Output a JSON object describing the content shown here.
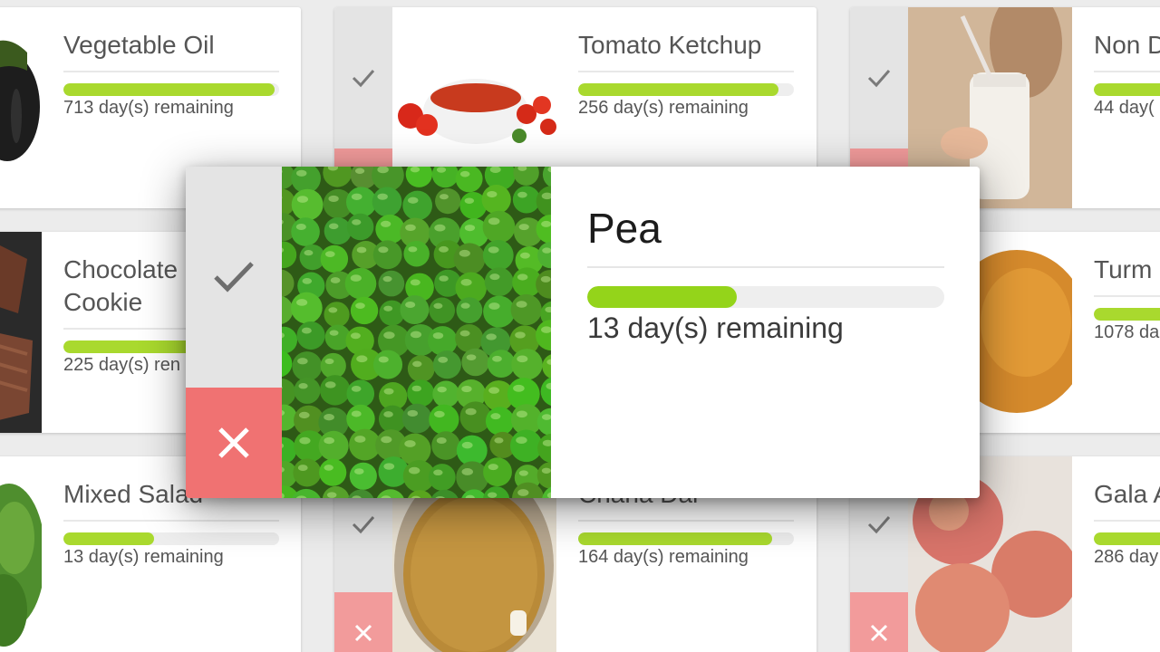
{
  "cards": [
    {
      "id": "vegetable-oil",
      "title": "Vegetable Oil",
      "remaining": "713 day(s) remaining",
      "progress": 0.98
    },
    {
      "id": "tomato-ketchup",
      "title": "Tomato Ketchup",
      "remaining": "256 day(s) remaining",
      "progress": 0.93
    },
    {
      "id": "non-dairy",
      "title": "Non D",
      "remaining": "44 day(",
      "progress": 0.9
    },
    {
      "id": "chocolate-cookie",
      "title_line1": "Chocolate",
      "title_line2": "Cookie",
      "remaining": "225 day(s) ren",
      "progress": 0.9
    },
    {
      "id": "turmeric",
      "title": "Turm",
      "remaining": "1078 da",
      "progress": 0.95
    },
    {
      "id": "mixed-salad",
      "title": "Mixed Salad",
      "remaining": "13 day(s) remaining",
      "progress": 0.42
    },
    {
      "id": "chana-dal",
      "title": "Chana Dal",
      "remaining": "164 day(s) remaining",
      "progress": 0.9
    },
    {
      "id": "gala-apple",
      "title": "Gala A",
      "remaining": "286 day",
      "progress": 0.9
    }
  ],
  "modal": {
    "title": "Pea",
    "remaining": "13 day(s) remaining",
    "progress": 0.42
  },
  "colors": {
    "progress": "#a9d92e",
    "cross_light": "#f29b9b",
    "cross_modal": "#f07272",
    "check_bg": "#e4e4e4"
  },
  "icons": {
    "check": "check-icon",
    "close": "close-icon"
  }
}
